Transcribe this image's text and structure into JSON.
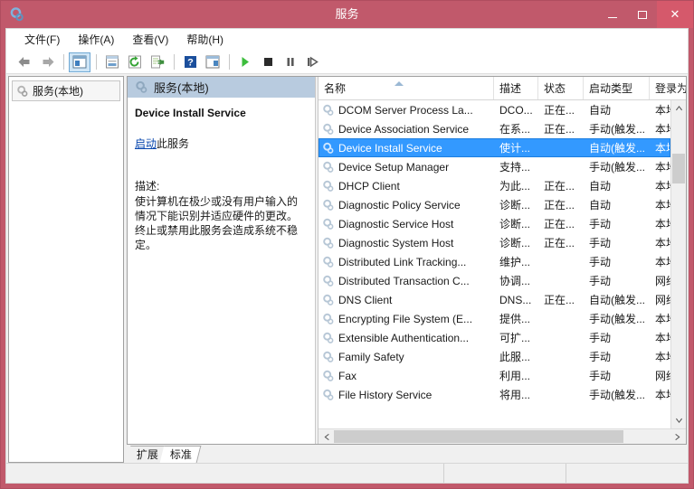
{
  "window": {
    "title": "服务",
    "app_icon": "services-gear-icon",
    "titlebar_color": "#c1596b",
    "controls": {
      "minimize": "minimize-icon",
      "maximize": "maximize-icon",
      "close": "✕"
    }
  },
  "menubar": {
    "items": [
      {
        "label": "文件(F)",
        "name": "menu-file"
      },
      {
        "label": "操作(A)",
        "name": "menu-action"
      },
      {
        "label": "查看(V)",
        "name": "menu-view"
      },
      {
        "label": "帮助(H)",
        "name": "menu-help"
      }
    ]
  },
  "toolbar": {
    "buttons": [
      {
        "name": "back-icon",
        "glyph": "back",
        "active": false
      },
      {
        "name": "forward-icon",
        "glyph": "forward",
        "active": false
      },
      {
        "name": "show-hide-tree-icon",
        "glyph": "treepane",
        "active": true
      },
      {
        "name": "properties-icon",
        "glyph": "props",
        "active": false
      },
      {
        "name": "refresh-icon",
        "glyph": "refresh",
        "active": false
      },
      {
        "name": "export-list-icon",
        "glyph": "export",
        "active": false
      },
      {
        "name": "help-icon",
        "glyph": "help",
        "active": false
      },
      {
        "name": "show-action-pane-icon",
        "glyph": "actionpane",
        "active": false
      },
      {
        "name": "start-service-icon",
        "glyph": "play",
        "active": false
      },
      {
        "name": "stop-service-icon",
        "glyph": "stop",
        "active": false
      },
      {
        "name": "pause-service-icon",
        "glyph": "pause",
        "active": false
      },
      {
        "name": "restart-service-icon",
        "glyph": "restart",
        "active": false
      }
    ]
  },
  "tree": {
    "items": [
      {
        "label": "服务(本地)",
        "icon": "services-gear-icon",
        "selected": true
      }
    ]
  },
  "details": {
    "header": "服务(本地)",
    "header_icon": "services-gear-icon",
    "service_name": "Device Install Service",
    "action_link": "启动",
    "action_suffix": "此服务",
    "description_label": "描述:",
    "description": "使计算机在极少或没有用户输入的情况下能识别并适应硬件的更改。终止或禁用此服务会造成系统不稳定。"
  },
  "list": {
    "columns": [
      {
        "key": "name",
        "label": "名称",
        "sorted": true
      },
      {
        "key": "desc",
        "label": "描述",
        "sorted": false
      },
      {
        "key": "state",
        "label": "状态",
        "sorted": false
      },
      {
        "key": "start",
        "label": "启动类型",
        "sorted": false
      },
      {
        "key": "logon",
        "label": "登录为",
        "sorted": false
      }
    ],
    "rows": [
      {
        "name": "DCOM Server Process La...",
        "desc": "DCO...",
        "state": "正在...",
        "start": "自动",
        "logon": "本地系",
        "selected": false
      },
      {
        "name": "Device Association Service",
        "desc": "在系...",
        "state": "正在...",
        "start": "手动(触发...",
        "logon": "本地系",
        "selected": false
      },
      {
        "name": "Device Install Service",
        "desc": "使计...",
        "state": "",
        "start": "自动(触发...",
        "logon": "本地系",
        "selected": true
      },
      {
        "name": "Device Setup Manager",
        "desc": "支持...",
        "state": "",
        "start": "手动(触发...",
        "logon": "本地系",
        "selected": false
      },
      {
        "name": "DHCP Client",
        "desc": "为此...",
        "state": "正在...",
        "start": "自动",
        "logon": "本地服",
        "selected": false
      },
      {
        "name": "Diagnostic Policy Service",
        "desc": "诊断...",
        "state": "正在...",
        "start": "自动",
        "logon": "本地服",
        "selected": false
      },
      {
        "name": "Diagnostic Service Host",
        "desc": "诊断...",
        "state": "正在...",
        "start": "手动",
        "logon": "本地服",
        "selected": false
      },
      {
        "name": "Diagnostic System Host",
        "desc": "诊断...",
        "state": "正在...",
        "start": "手动",
        "logon": "本地系",
        "selected": false
      },
      {
        "name": "Distributed Link Tracking...",
        "desc": "维护...",
        "state": "",
        "start": "手动",
        "logon": "本地系",
        "selected": false
      },
      {
        "name": "Distributed Transaction C...",
        "desc": "协调...",
        "state": "",
        "start": "手动",
        "logon": "网络服",
        "selected": false
      },
      {
        "name": "DNS Client",
        "desc": "DNS...",
        "state": "正在...",
        "start": "自动(触发...",
        "logon": "网络服",
        "selected": false
      },
      {
        "name": "Encrypting File System (E...",
        "desc": "提供...",
        "state": "",
        "start": "手动(触发...",
        "logon": "本地系",
        "selected": false
      },
      {
        "name": "Extensible Authentication...",
        "desc": "可扩...",
        "state": "",
        "start": "手动",
        "logon": "本地系",
        "selected": false
      },
      {
        "name": "Family Safety",
        "desc": "此服...",
        "state": "",
        "start": "手动",
        "logon": "本地服",
        "selected": false
      },
      {
        "name": "Fax",
        "desc": "利用...",
        "state": "",
        "start": "手动",
        "logon": "网络服",
        "selected": false
      },
      {
        "name": "File History Service",
        "desc": "将用...",
        "state": "",
        "start": "手动(触发...",
        "logon": "本地系",
        "selected": false
      }
    ],
    "row_icon": "service-gear-icon",
    "selection_color": "#3399ff"
  },
  "scrollbars": {
    "vertical": {
      "up": "▲",
      "down": "▼"
    },
    "horizontal": {
      "left": "◄",
      "right": "►"
    }
  },
  "tabs": [
    {
      "label": "扩展",
      "active": false
    },
    {
      "label": "标准",
      "active": true
    }
  ],
  "statusbar": {
    "text": ""
  }
}
